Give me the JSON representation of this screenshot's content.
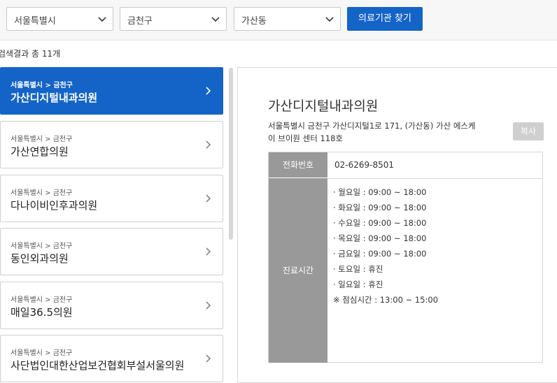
{
  "filters": {
    "city": "서울특별시",
    "district": "금천구",
    "dong": "가산동",
    "search_button": "의료기관 찾기"
  },
  "results": {
    "count_text": "검색결과 총 11개",
    "items": [
      {
        "region": "서울특별시 > 금천구",
        "name": "가산디지털내과의원",
        "active": true
      },
      {
        "region": "서울특별시 > 금천구",
        "name": "가산연합의원"
      },
      {
        "region": "서울특별시 > 금천구",
        "name": "다나이비인후과의원"
      },
      {
        "region": "서울특별시 > 금천구",
        "name": "동인외과의원"
      },
      {
        "region": "서울특별시 > 금천구",
        "name": "매일36.5의원"
      },
      {
        "region": "서울특별시 > 금천구",
        "name": "사단법인대한산업보건협회부설서울의원"
      }
    ]
  },
  "detail": {
    "title": "가산디지털내과의원",
    "address": "서울특별시 금천구 가산디지털1로 171, (가산동) 가산 에스케이 브이원 센터 118호",
    "copy_button": "복사",
    "phone_label": "전화번호",
    "phone": "02-6269-8501",
    "hours_label": "진료시간",
    "hours": [
      "· 월요일 : 09:00 ~ 18:00",
      "· 화요일 : 09:00 ~ 18:00",
      "· 수요일 : 09:00 ~ 18:00",
      "· 목요일 : 09:00 ~ 18:00",
      "· 금요일 : 09:00 ~ 18:00",
      "· 토요일 : 휴진",
      "· 일요일 : 휴진",
      "※ 점심시간 : 13:00 ~ 15:00"
    ]
  },
  "colors": {
    "accent": "#1464c8",
    "label_bg": "#999999"
  }
}
